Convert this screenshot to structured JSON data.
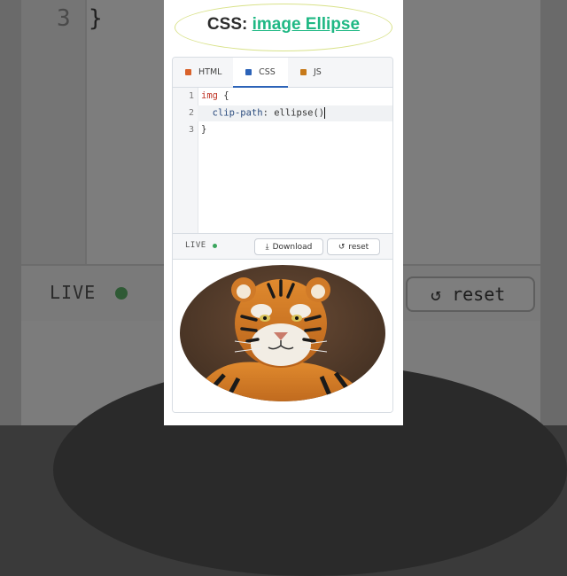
{
  "title": {
    "prefix": "CSS:",
    "link": "image Ellipse"
  },
  "tabs": [
    {
      "label": "HTML",
      "color": "#d9622b"
    },
    {
      "label": "CSS",
      "color": "#2c63b8"
    },
    {
      "label": "JS",
      "color": "#c77a1a"
    }
  ],
  "code": {
    "line_numbers": [
      "1",
      "2",
      "3"
    ],
    "line1": {
      "selector": "img",
      "rest": " {"
    },
    "line2": {
      "indent": "  ",
      "property": "clip-path",
      "value": ": ellipse()"
    },
    "line3": "}"
  },
  "live": {
    "label": "LIVE",
    "status_color": "#3aa55d"
  },
  "buttons": {
    "download": "Download",
    "reset": "reset"
  },
  "background": {
    "line_number": "3",
    "brace": "}",
    "live": "LIVE",
    "reset": "reset"
  },
  "preview": {
    "image_alt": "tiger"
  }
}
